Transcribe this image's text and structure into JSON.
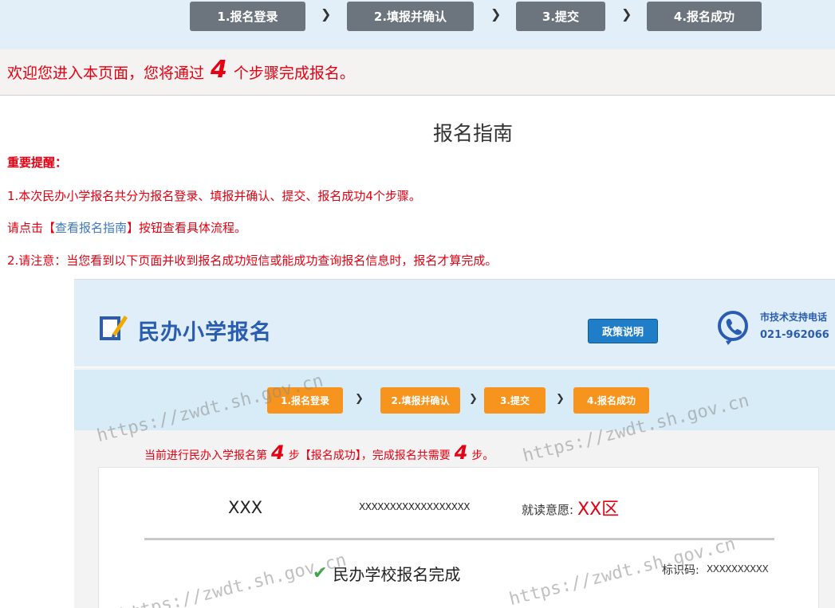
{
  "steps": {
    "s1": "1.报名登录",
    "s2": "2.填报并确认",
    "s3": "3.提交",
    "s4": "4.报名成功"
  },
  "welcome": {
    "prefix": "欢迎您进入本页面，您将通过",
    "count": "4",
    "suffix": "个步骤完成报名。"
  },
  "guide": {
    "title": "报名指南",
    "reminder_heading": "重要提醒：",
    "line1": "1.本次民办小学报名共分为报名登录、填报并确认、提交、报名成功4个步骤。",
    "line2_prefix": "请点击【",
    "line2_link": "查看报名指南",
    "line2_suffix": "】按钮查看具体流程。",
    "line3": "2.请注意：当您看到以下页面并收到报名成功短信或能成功查询报名信息时，报名才算完成。"
  },
  "sample": {
    "logo_text": "民办小学报名",
    "policy_button": "政策说明",
    "support_label": "市技术支持电话",
    "support_phone": "021-962066",
    "steps": {
      "s1": "1.报名登录",
      "s2": "2.填报并确认",
      "s3": "3.提交",
      "s4": "4.报名成功"
    },
    "status": {
      "part1": "当前进行民办入学报名第",
      "current": "4",
      "part2": "步【报名成功】，完成报名共需要",
      "total": "4",
      "part3": "步。"
    },
    "card": {
      "name": "XXX",
      "id": "XXXXXXXXXXXXXXXXXX",
      "intent_label": "就读意愿:",
      "intent_value": "XX区",
      "done_text": "民办学校报名完成",
      "code_label": "标识码:",
      "code_value": "XXXXXXXXXX"
    },
    "watermark": "https://zwdt.sh.gov.cn"
  },
  "colors": {
    "accent_red": "#e60012",
    "step_gray": "#6c757d",
    "step_orange": "#f7941d",
    "brand_blue": "#2a5db0"
  }
}
